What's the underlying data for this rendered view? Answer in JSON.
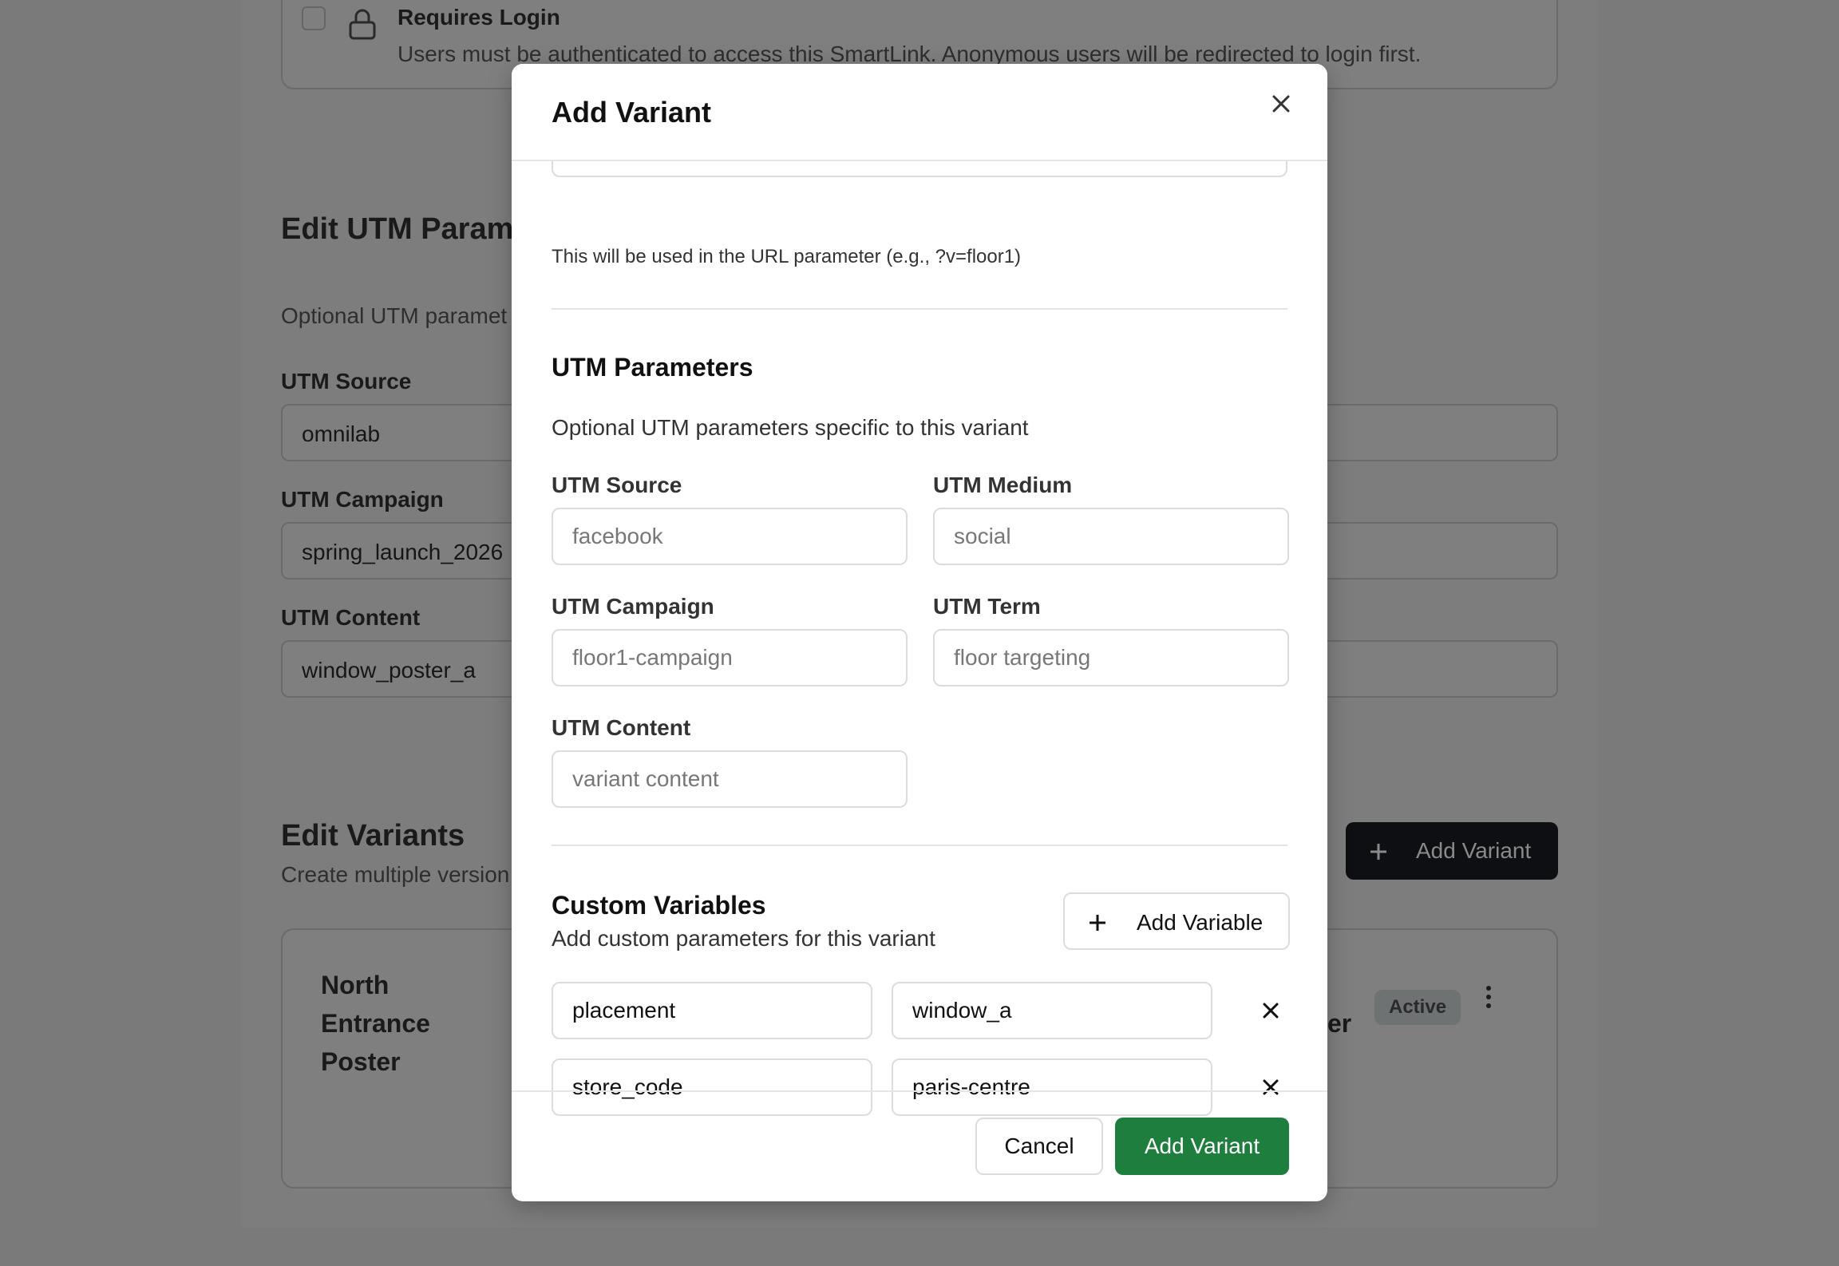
{
  "background": {
    "login": {
      "title": "Requires Login",
      "description": "Users must be authenticated to access this SmartLink. Anonymous users will be redirected to login first."
    },
    "utm_section": {
      "title": "Edit UTM Parame",
      "subtitle": "Optional UTM paramet",
      "source_label": "UTM Source",
      "source_value": "omnilab",
      "campaign_label": "UTM Campaign",
      "campaign_value": "spring_launch_2026",
      "content_label": "UTM Content",
      "content_value": "window_poster_a"
    },
    "variants_section": {
      "title": "Edit Variants",
      "subtitle": "Create multiple version",
      "add_variant_label": "Add Variant",
      "card_title": "North Entrance Poster",
      "card_right_fragment": "er",
      "status_badge": "Active"
    }
  },
  "modal": {
    "title": "Add Variant",
    "url_hint": "This will be used in the URL parameter (e.g., ?v=floor1)",
    "utm": {
      "title": "UTM Parameters",
      "subtitle": "Optional UTM parameters specific to this variant",
      "source_label": "UTM Source",
      "source_placeholder": "facebook",
      "medium_label": "UTM Medium",
      "medium_placeholder": "social",
      "campaign_label": "UTM Campaign",
      "campaign_placeholder": "floor1-campaign",
      "term_label": "UTM Term",
      "term_placeholder": "floor targeting",
      "content_label": "UTM Content",
      "content_placeholder": "variant content"
    },
    "custom_vars": {
      "title": "Custom Variables",
      "subtitle": "Add custom parameters for this variant",
      "add_label": "Add Variable",
      "rows": [
        {
          "key": "placement",
          "value": "window_a"
        },
        {
          "key": "store_code",
          "value": "paris-centre"
        }
      ]
    },
    "footer": {
      "cancel_label": "Cancel",
      "submit_label": "Add Variant"
    }
  },
  "colors": {
    "overlay": "#7a7a7a",
    "primary_green": "#1e7e3e",
    "dark_button": "#0d0f12"
  }
}
